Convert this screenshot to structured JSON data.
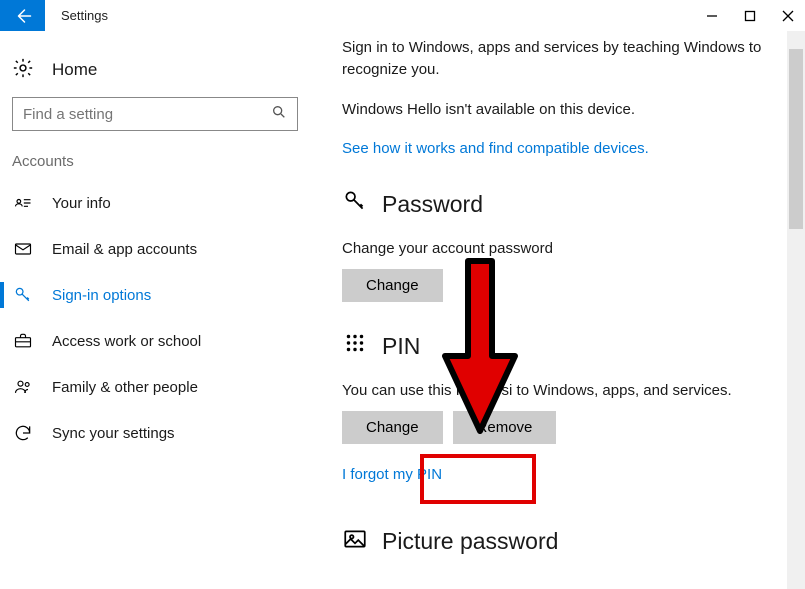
{
  "window": {
    "title": "Settings"
  },
  "sidebar": {
    "home_label": "Home",
    "search_placeholder": "Find a setting",
    "category": "Accounts",
    "items": [
      {
        "label": "Your info"
      },
      {
        "label": "Email & app accounts"
      },
      {
        "label": "Sign-in options"
      },
      {
        "label": "Access work or school"
      },
      {
        "label": "Family & other people"
      },
      {
        "label": "Sync your settings"
      }
    ],
    "active_index": 2
  },
  "content": {
    "intro_line": "Sign in to Windows, apps and services by teaching Windows to recognize you.",
    "hello_unavailable": "Windows Hello isn't available on this device.",
    "compat_link": "See how it works and find compatible devices.",
    "password": {
      "heading": "Password",
      "desc": "Change your account password",
      "change_label": "Change"
    },
    "pin": {
      "heading": "PIN",
      "desc_before": "You can use this PIN to si",
      "desc_after": " to Windows, apps, and services.",
      "change_label": "Change",
      "remove_label": "Remove",
      "forgot_link": "I forgot my PIN"
    },
    "picture": {
      "heading": "Picture password"
    }
  },
  "annotation": {
    "arrow_color": "#e00000",
    "highlight_color": "#e00000"
  }
}
